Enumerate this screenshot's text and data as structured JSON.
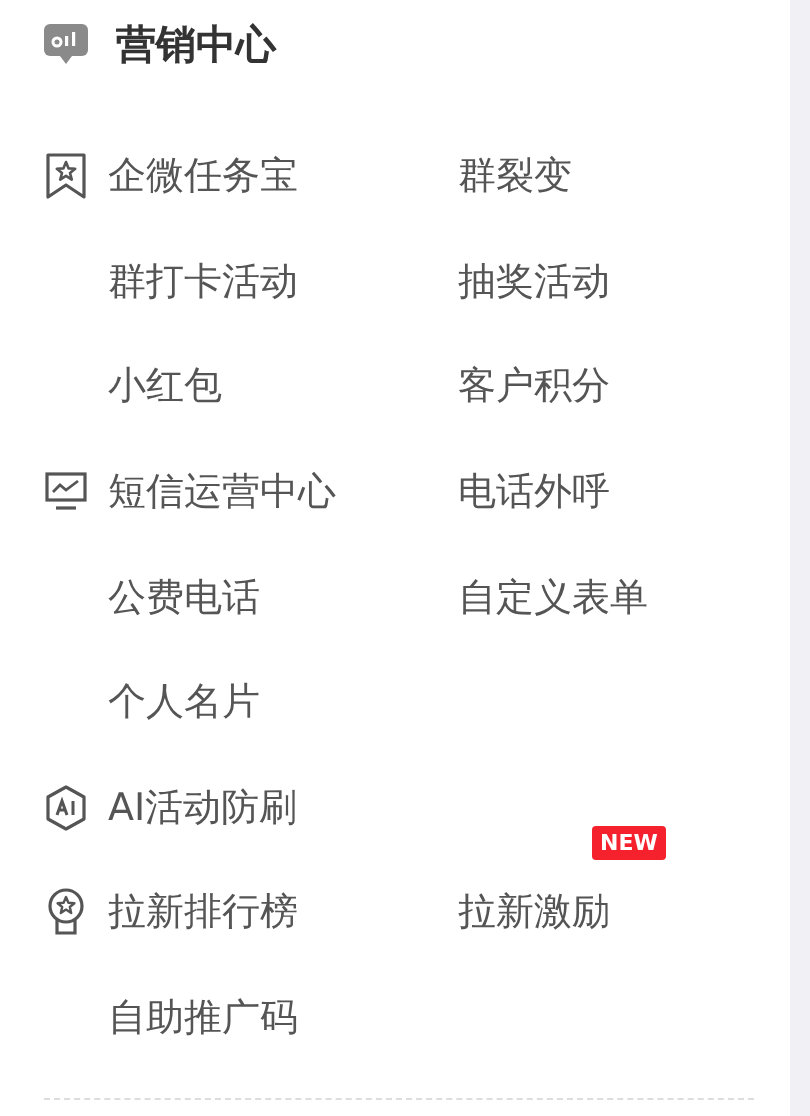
{
  "header": {
    "title": "营销中心"
  },
  "rows": [
    {
      "kind": "bookmark",
      "left": {
        "label": "企微任务宝"
      },
      "right": {
        "label": "群裂变"
      }
    },
    {
      "kind": "plain",
      "left": {
        "label": "群打卡活动"
      },
      "right": {
        "label": "抽奖活动"
      }
    },
    {
      "kind": "plain",
      "left": {
        "label": "小红包"
      },
      "right": {
        "label": "客户积分"
      }
    },
    {
      "kind": "monitor",
      "left": {
        "label": "短信运营中心"
      },
      "right": {
        "label": "电话外呼"
      }
    },
    {
      "kind": "plain",
      "left": {
        "label": "公费电话"
      },
      "right": {
        "label": "自定义表单"
      }
    },
    {
      "kind": "plain",
      "left": {
        "label": "个人名片"
      }
    },
    {
      "kind": "hexagon",
      "left": {
        "label": "AI活动防刷"
      }
    },
    {
      "kind": "medal",
      "left": {
        "label": "拉新排行榜"
      },
      "right": {
        "label": "拉新激励",
        "badge": "NEW"
      }
    },
    {
      "kind": "plain",
      "left": {
        "label": "自助推广码"
      }
    }
  ]
}
